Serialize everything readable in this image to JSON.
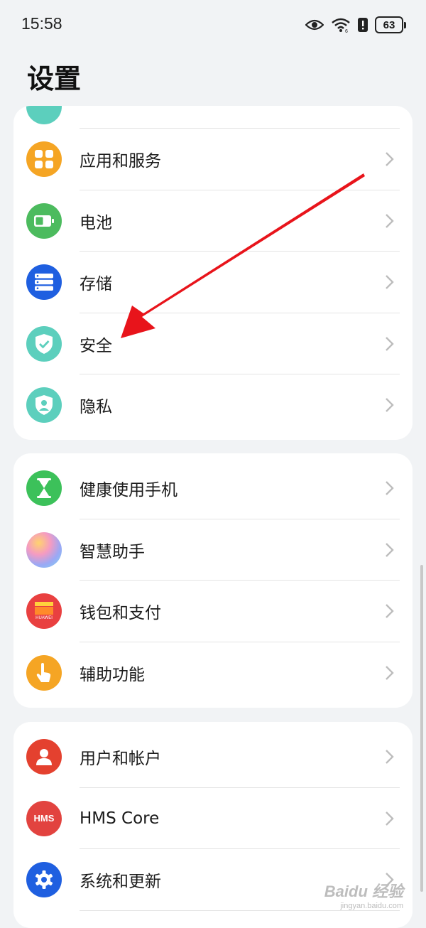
{
  "status": {
    "time": "15:58",
    "battery": "63",
    "icons": [
      "eye-icon",
      "wifi-icon",
      "alert-icon",
      "battery-icon"
    ]
  },
  "page": {
    "title": "设置"
  },
  "groups": [
    {
      "items": [
        {
          "label": "应用和服务",
          "icon": "apps-icon",
          "color": "#f5a524"
        },
        {
          "label": "电池",
          "icon": "battery-icon",
          "color": "#4cbb5e"
        },
        {
          "label": "存储",
          "icon": "storage-icon",
          "color": "#1f5fe0"
        },
        {
          "label": "安全",
          "icon": "shield-check-icon",
          "color": "#5ccfbd"
        },
        {
          "label": "隐私",
          "icon": "privacy-shield-icon",
          "color": "#5ccfbd"
        }
      ]
    },
    {
      "items": [
        {
          "label": "健康使用手机",
          "icon": "hourglass-icon",
          "color": "#3cc15a"
        },
        {
          "label": "智慧助手",
          "icon": "assistant-icon",
          "color": "#b9a8f0"
        },
        {
          "label": "钱包和支付",
          "icon": "wallet-icon",
          "color": "#e94040",
          "icon_text": "HUAWEI"
        },
        {
          "label": "辅助功能",
          "icon": "hand-icon",
          "color": "#f5a524"
        }
      ]
    },
    {
      "items": [
        {
          "label": "用户和帐户",
          "icon": "user-icon",
          "color": "#e4412f"
        },
        {
          "label": "HMS Core",
          "icon": "hms-icon",
          "color": "#e2433f",
          "icon_text": "HMS"
        },
        {
          "label": "系统和更新",
          "icon": "gear-icon",
          "color": "#1f5fe0"
        }
      ]
    }
  ],
  "watermark": {
    "main": "Baidu 经验",
    "sub": "jingyan.baidu.com"
  }
}
